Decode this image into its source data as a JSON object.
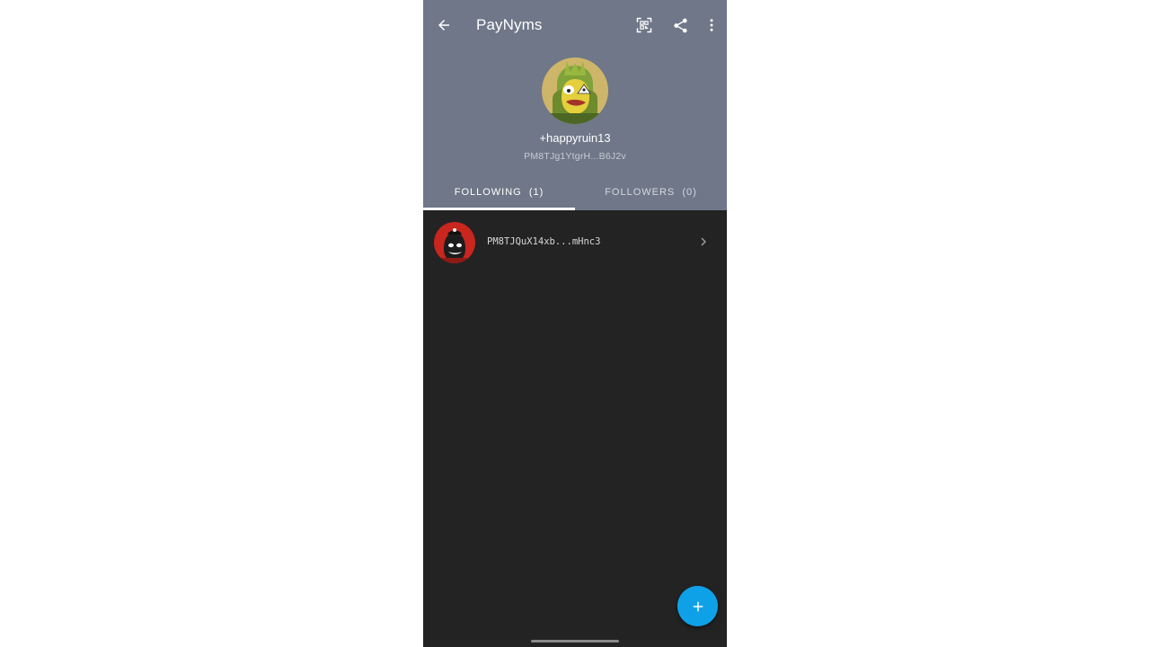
{
  "appbar": {
    "title": "PayNyms",
    "icons": {
      "back": "arrow-back-icon",
      "qr": "qr-scan-icon",
      "share": "share-icon",
      "more": "more-vert-icon"
    }
  },
  "profile": {
    "nym": "+happyruin13",
    "code": "PM8TJg1YtgrH...B6J2v",
    "avatar": "frog-avatar-icon"
  },
  "tabs": {
    "following": "FOLLOWING  (1)",
    "followers": "FOLLOWERS  (0)",
    "active": "following"
  },
  "following_list": [
    {
      "code": "PM8TJQuX14xb...mHnc3",
      "avatar": "red-avatar-icon"
    }
  ],
  "fab": {
    "icon": "plus-icon"
  },
  "colors": {
    "header": "#6f7788",
    "background": "#232323",
    "accent": "#0fa1e8"
  }
}
